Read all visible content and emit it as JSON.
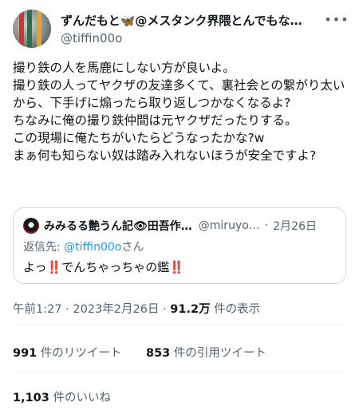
{
  "author": {
    "display_name": "ずんだもと🦋@メスタンク界隈とんでもな…",
    "handle": "@tiffin00o"
  },
  "more_icon": "more-horizontal-icon",
  "tweet": {
    "text": "撮り鉄の人を馬鹿にしない方が良いよ。\n撮り鉄の人ってヤクザの友達多くて、裏社会との繋がり太いから、下手げに煽ったら取り返しつかなくなるよ?\nちなみに俺の撮り鉄仲間は元ヤクザだったりする。\nこの現場に俺たちがいたらどうなったかな?w\nまぁ何も知らない奴は踏み入れないほうが安全ですよ?"
  },
  "quote": {
    "display_name": "みみるる艶うん記👁田吾作…",
    "handle": "@miruyo…",
    "separator": "·",
    "date": "2月26日",
    "reply_prefix": "返信先: ",
    "reply_to": "@tiffin00o",
    "reply_suffix": "さん",
    "text": "よっ‼️でんちゃっちゃの鑑‼️"
  },
  "meta": {
    "time": "午前1:27",
    "sep1": " · ",
    "date": "2023年2月26日",
    "sep2": " · ",
    "views_count": "91.2万",
    "views_label": " 件の表示"
  },
  "stats": {
    "retweets_count": "991",
    "retweets_label": " 件のリツイート",
    "quotes_count": "853",
    "quotes_label": " 件の引用ツイート",
    "likes_count": "1,103",
    "likes_label": " 件のいいね"
  },
  "colors": {
    "text": "#0f1419",
    "secondary": "#536471",
    "link": "#1d9bf0",
    "border": "#cfd9de",
    "divider": "#eff3f4"
  }
}
